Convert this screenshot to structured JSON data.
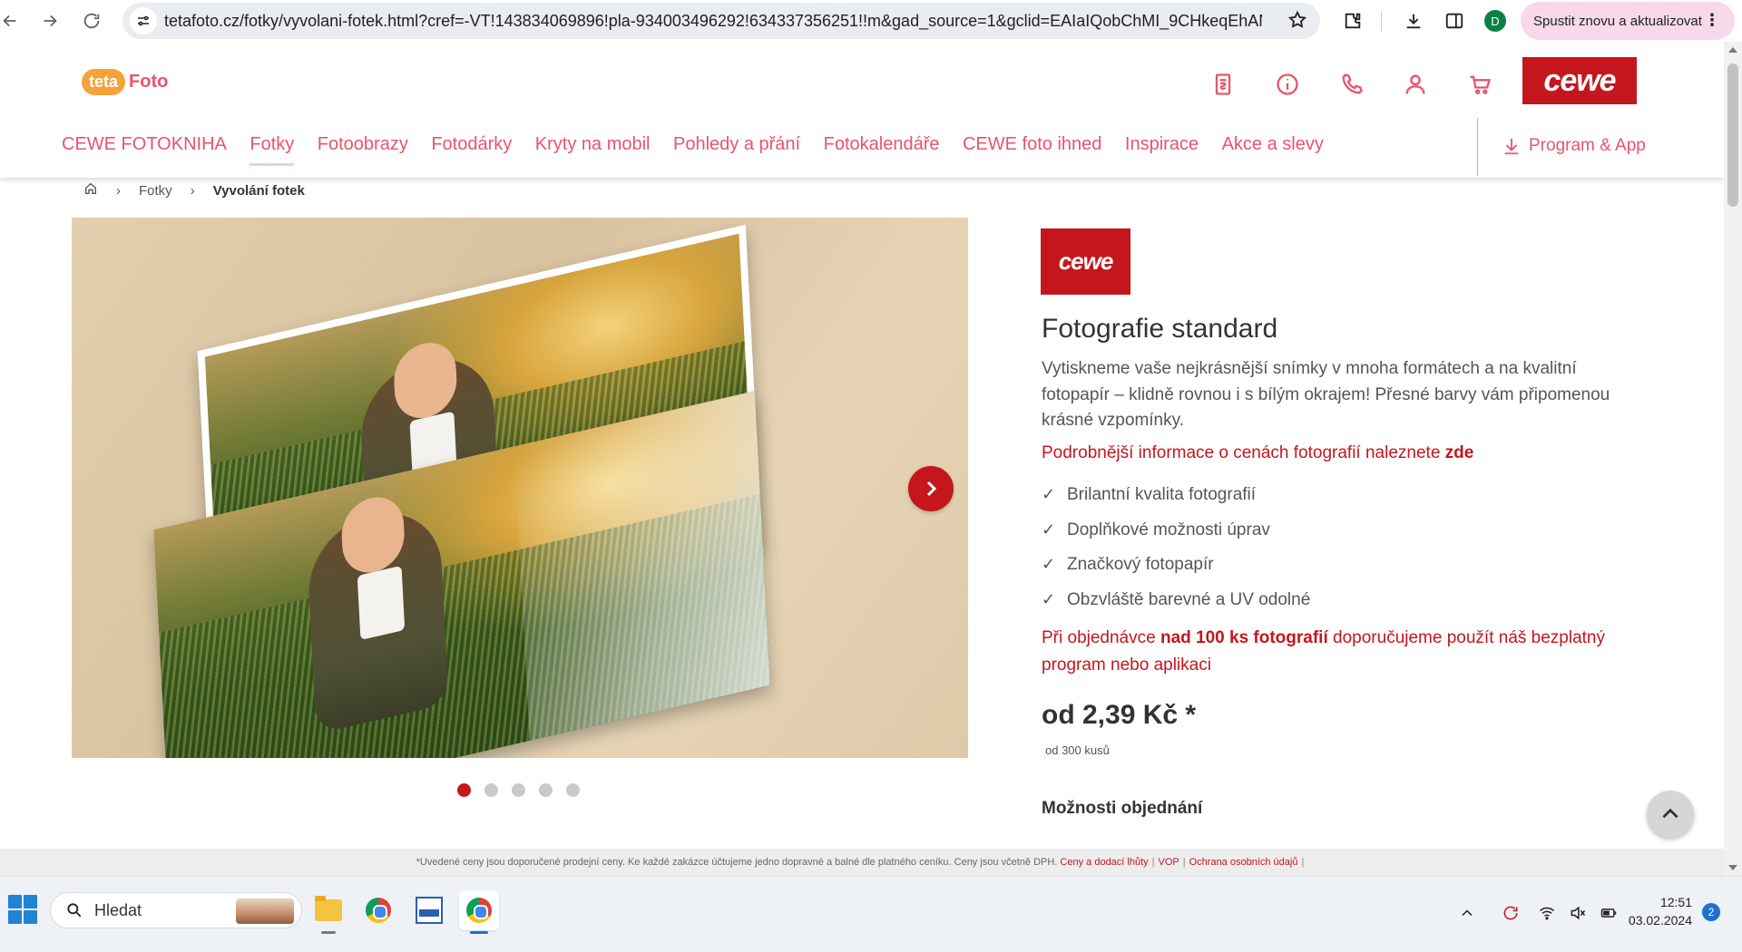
{
  "browser": {
    "url": "tetafoto.cz/fotky/vyvolani-fotek.html?cref=-VT!143834069896!pla-934003496292!634337356251!!m&gad_source=1&gclid=EAIaIQobChMI_9CHkeqEhAMVq...",
    "profile_initial": "D",
    "update_button_label": "Spustit znovu a aktualizovat"
  },
  "header": {
    "logo_teta": "teta",
    "logo_foto": "Foto",
    "cewe_logo": "cewe",
    "nav": [
      {
        "label": "CEWE FOTOKNIHA",
        "active": false
      },
      {
        "label": "Fotky",
        "active": true
      },
      {
        "label": "Fotoobrazy",
        "active": false
      },
      {
        "label": "Fotodárky",
        "active": false
      },
      {
        "label": "Kryty na mobil",
        "active": false
      },
      {
        "label": "Pohledy a přání",
        "active": false
      },
      {
        "label": "Fotokalendáře",
        "active": false
      },
      {
        "label": "CEWE foto ihned",
        "active": false
      },
      {
        "label": "Inspirace",
        "active": false
      },
      {
        "label": "Akce a slevy",
        "active": false
      }
    ],
    "program_app": "Program & App",
    "icons": [
      "receipt-icon",
      "info-icon",
      "phone-icon",
      "user-icon",
      "cart-icon"
    ]
  },
  "breadcrumb": {
    "home_icon": "home-icon",
    "items": [
      "Fotky",
      "Vyvolání fotek"
    ]
  },
  "carousel": {
    "slide_count": 5,
    "active_slide": 1
  },
  "product": {
    "badge": "cewe",
    "title": "Fotografie standard",
    "description": "Vytiskneme vaše nejkrásnější snímky v mnoha formátech a na kvalitní fotopapír – klidně rovnou i s bílým okrajem! Přesné barvy vám připomenou krásné vzpomínky.",
    "price_info_text": "Podrobnější informace o cenách fotografií naleznete ",
    "price_info_link": "zde",
    "features": [
      "Brilantní kvalita fotografií",
      "Doplňkové možnosti úprav",
      "Značkový fotopapír",
      "Obzvláště barevné a UV odolné"
    ],
    "bulk_note_pre": "Při objednávce ",
    "bulk_note_bold": "nad 100 ks fotografií",
    "bulk_note_post": " doporučujeme použít náš bezplatný program nebo aplikaci",
    "price": "od 2,39 Kč *",
    "price_sub": "od 300 kusů",
    "order_options": "Možnosti objednání"
  },
  "footer_note": {
    "text": "*Uvedené ceny jsou doporučené prodejní ceny. Ke každé zakázce účtujeme jedno dopravné a balné dle platného ceníku. Ceny jsou včetně DPH.",
    "links": [
      "Ceny a dodací lhůty",
      "VOP",
      "Ochrana osobních údajů"
    ]
  },
  "taskbar": {
    "search_placeholder": "Hledat",
    "time": "12:51",
    "date": "03.02.2024",
    "notification_count": "2"
  },
  "colors": {
    "brand_red": "#c4161c",
    "nav_pink": "#e9546b"
  }
}
